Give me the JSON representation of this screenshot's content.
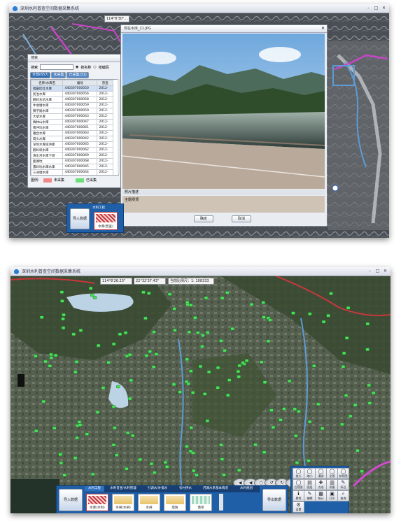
{
  "screenshot1": {
    "window_title": "深圳水利普查空间数据采集系统",
    "coordinates": "114°8'30\"...",
    "list_panel": {
      "title": "搜索",
      "search_label": "搜索",
      "search_value": "",
      "radio_name": "按名称",
      "radio_code": "按编码",
      "tab_all": "全部(657)",
      "tab_collected": "未采集",
      "tab_uncollected": "已采集(31)",
      "columns": [
        "名称/水库名",
        "编号",
        "普查"
      ],
      "rows": [
        [
          "福田区红水库",
          "440307000050",
          "2012-"
        ],
        [
          "民治水库",
          "440307000056",
          "2012-"
        ],
        [
          "鹅岭东坑水库",
          "440307000058",
          "2012-"
        ],
        [
          "牛地塘水库",
          "440307000059",
          "2012-"
        ],
        [
          "狮子尾水库",
          "440307000059",
          "2012-"
        ],
        [
          "大望水库",
          "440307000043",
          "2012-"
        ],
        [
          "梅林山水库",
          "440307000047",
          "2012-"
        ],
        [
          "南坪坑水库",
          "440307000061",
          "2012-"
        ],
        [
          "雅合水库",
          "440307000063",
          "2012-"
        ],
        [
          "岗头水库",
          "440307000042",
          "2012-"
        ],
        [
          "深圳水库排洪库",
          "440307000065",
          "2012-"
        ],
        [
          "鹅岭坝水库",
          "440307000062",
          "2012-"
        ],
        [
          "清水河水库下游",
          "440307000069",
          "2012-"
        ],
        [
          "鹿湖坑",
          "440307000068",
          "2012-"
        ],
        [
          "雷岭坑水库水库",
          "440307000045",
          "2012-"
        ],
        [
          "三洲塘水库",
          "440307000044",
          "2012-"
        ],
        [
          "公路坝",
          "440307000046",
          "2012-"
        ],
        [
          "三涌坝水库",
          "440307000048",
          "2012-"
        ]
      ],
      "legend_title": "图例：",
      "legend_uncollected": "未采集",
      "legend_collected": "已采集"
    },
    "photo_dialog": {
      "title": "现在水库_21.JPG",
      "section_label": "照片描述",
      "description": "主题坝顶",
      "ok_label": "确定",
      "cancel_label": "取消"
    },
    "toolbar": {
      "import_label": "导入数据",
      "tab_label": "水利工程",
      "item_label": "水库(普查)"
    }
  },
  "screenshot2": {
    "window_title": "深圳水利普查空间数据采集系统",
    "coord_x": "114°8'26.23\"",
    "coord_y": "22°32'37.43\"",
    "scale_label": "当前比例尺：1:",
    "scale_value": "108333",
    "map_buttons": [
      "◀",
      "◀",
      "○",
      "↺",
      "↻",
      "◀"
    ],
    "bottom": {
      "import_label": "导入数据",
      "export_label": "导出数据",
      "tabs": [
        "水利工程",
        "水利普查/水利管理",
        "引调水/补排水",
        "农村供水",
        "河湖水系基本情况",
        "水利规划"
      ],
      "items": [
        {
          "label": "水库(水利)",
          "color": "#c8373c"
        },
        {
          "label": "水闸(水闸)",
          "color": "#e8c36a"
        },
        {
          "label": "水闸",
          "color": "#e8c36a"
        },
        {
          "label": "堤防",
          "color": "#e8c36a"
        },
        {
          "label": "塘坝",
          "color": "#a0d8c0"
        }
      ]
    },
    "tools": [
      {
        "label": "放大",
        "icon": "◯"
      },
      {
        "label": "缩小",
        "icon": "◯"
      },
      {
        "label": "漫游",
        "icon": "◯"
      },
      {
        "label": "全图",
        "icon": "◯"
      },
      {
        "label": "前视图",
        "icon": "◯"
      },
      {
        "label": "后视图",
        "icon": "◯"
      },
      {
        "label": "图层",
        "icon": "▤"
      },
      {
        "label": "点选",
        "icon": "✚"
      },
      {
        "label": "测量",
        "icon": "▥"
      },
      {
        "label": "标注",
        "icon": "✎"
      },
      {
        "label": "属性",
        "icon": "ℹ"
      },
      {
        "label": "编辑",
        "icon": "✎"
      },
      {
        "label": "统计",
        "icon": "▦"
      },
      {
        "label": "打印",
        "icon": "▣"
      },
      {
        "label": "查询",
        "icon": "⌕"
      },
      {
        "label": "设置",
        "icon": "⚙"
      }
    ]
  }
}
